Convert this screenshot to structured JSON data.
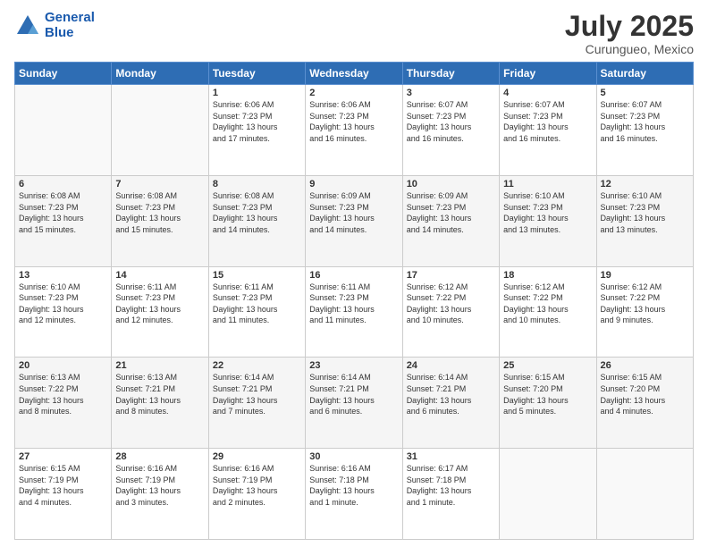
{
  "header": {
    "logo_line1": "General",
    "logo_line2": "Blue",
    "month_year": "July 2025",
    "location": "Curungueo, Mexico"
  },
  "days_of_week": [
    "Sunday",
    "Monday",
    "Tuesday",
    "Wednesday",
    "Thursday",
    "Friday",
    "Saturday"
  ],
  "weeks": [
    [
      {
        "day": "",
        "info": ""
      },
      {
        "day": "",
        "info": ""
      },
      {
        "day": "1",
        "info": "Sunrise: 6:06 AM\nSunset: 7:23 PM\nDaylight: 13 hours\nand 17 minutes."
      },
      {
        "day": "2",
        "info": "Sunrise: 6:06 AM\nSunset: 7:23 PM\nDaylight: 13 hours\nand 16 minutes."
      },
      {
        "day": "3",
        "info": "Sunrise: 6:07 AM\nSunset: 7:23 PM\nDaylight: 13 hours\nand 16 minutes."
      },
      {
        "day": "4",
        "info": "Sunrise: 6:07 AM\nSunset: 7:23 PM\nDaylight: 13 hours\nand 16 minutes."
      },
      {
        "day": "5",
        "info": "Sunrise: 6:07 AM\nSunset: 7:23 PM\nDaylight: 13 hours\nand 16 minutes."
      }
    ],
    [
      {
        "day": "6",
        "info": "Sunrise: 6:08 AM\nSunset: 7:23 PM\nDaylight: 13 hours\nand 15 minutes."
      },
      {
        "day": "7",
        "info": "Sunrise: 6:08 AM\nSunset: 7:23 PM\nDaylight: 13 hours\nand 15 minutes."
      },
      {
        "day": "8",
        "info": "Sunrise: 6:08 AM\nSunset: 7:23 PM\nDaylight: 13 hours\nand 14 minutes."
      },
      {
        "day": "9",
        "info": "Sunrise: 6:09 AM\nSunset: 7:23 PM\nDaylight: 13 hours\nand 14 minutes."
      },
      {
        "day": "10",
        "info": "Sunrise: 6:09 AM\nSunset: 7:23 PM\nDaylight: 13 hours\nand 14 minutes."
      },
      {
        "day": "11",
        "info": "Sunrise: 6:10 AM\nSunset: 7:23 PM\nDaylight: 13 hours\nand 13 minutes."
      },
      {
        "day": "12",
        "info": "Sunrise: 6:10 AM\nSunset: 7:23 PM\nDaylight: 13 hours\nand 13 minutes."
      }
    ],
    [
      {
        "day": "13",
        "info": "Sunrise: 6:10 AM\nSunset: 7:23 PM\nDaylight: 13 hours\nand 12 minutes."
      },
      {
        "day": "14",
        "info": "Sunrise: 6:11 AM\nSunset: 7:23 PM\nDaylight: 13 hours\nand 12 minutes."
      },
      {
        "day": "15",
        "info": "Sunrise: 6:11 AM\nSunset: 7:23 PM\nDaylight: 13 hours\nand 11 minutes."
      },
      {
        "day": "16",
        "info": "Sunrise: 6:11 AM\nSunset: 7:23 PM\nDaylight: 13 hours\nand 11 minutes."
      },
      {
        "day": "17",
        "info": "Sunrise: 6:12 AM\nSunset: 7:22 PM\nDaylight: 13 hours\nand 10 minutes."
      },
      {
        "day": "18",
        "info": "Sunrise: 6:12 AM\nSunset: 7:22 PM\nDaylight: 13 hours\nand 10 minutes."
      },
      {
        "day": "19",
        "info": "Sunrise: 6:12 AM\nSunset: 7:22 PM\nDaylight: 13 hours\nand 9 minutes."
      }
    ],
    [
      {
        "day": "20",
        "info": "Sunrise: 6:13 AM\nSunset: 7:22 PM\nDaylight: 13 hours\nand 8 minutes."
      },
      {
        "day": "21",
        "info": "Sunrise: 6:13 AM\nSunset: 7:21 PM\nDaylight: 13 hours\nand 8 minutes."
      },
      {
        "day": "22",
        "info": "Sunrise: 6:14 AM\nSunset: 7:21 PM\nDaylight: 13 hours\nand 7 minutes."
      },
      {
        "day": "23",
        "info": "Sunrise: 6:14 AM\nSunset: 7:21 PM\nDaylight: 13 hours\nand 6 minutes."
      },
      {
        "day": "24",
        "info": "Sunrise: 6:14 AM\nSunset: 7:21 PM\nDaylight: 13 hours\nand 6 minutes."
      },
      {
        "day": "25",
        "info": "Sunrise: 6:15 AM\nSunset: 7:20 PM\nDaylight: 13 hours\nand 5 minutes."
      },
      {
        "day": "26",
        "info": "Sunrise: 6:15 AM\nSunset: 7:20 PM\nDaylight: 13 hours\nand 4 minutes."
      }
    ],
    [
      {
        "day": "27",
        "info": "Sunrise: 6:15 AM\nSunset: 7:19 PM\nDaylight: 13 hours\nand 4 minutes."
      },
      {
        "day": "28",
        "info": "Sunrise: 6:16 AM\nSunset: 7:19 PM\nDaylight: 13 hours\nand 3 minutes."
      },
      {
        "day": "29",
        "info": "Sunrise: 6:16 AM\nSunset: 7:19 PM\nDaylight: 13 hours\nand 2 minutes."
      },
      {
        "day": "30",
        "info": "Sunrise: 6:16 AM\nSunset: 7:18 PM\nDaylight: 13 hours\nand 1 minute."
      },
      {
        "day": "31",
        "info": "Sunrise: 6:17 AM\nSunset: 7:18 PM\nDaylight: 13 hours\nand 1 minute."
      },
      {
        "day": "",
        "info": ""
      },
      {
        "day": "",
        "info": ""
      }
    ]
  ]
}
